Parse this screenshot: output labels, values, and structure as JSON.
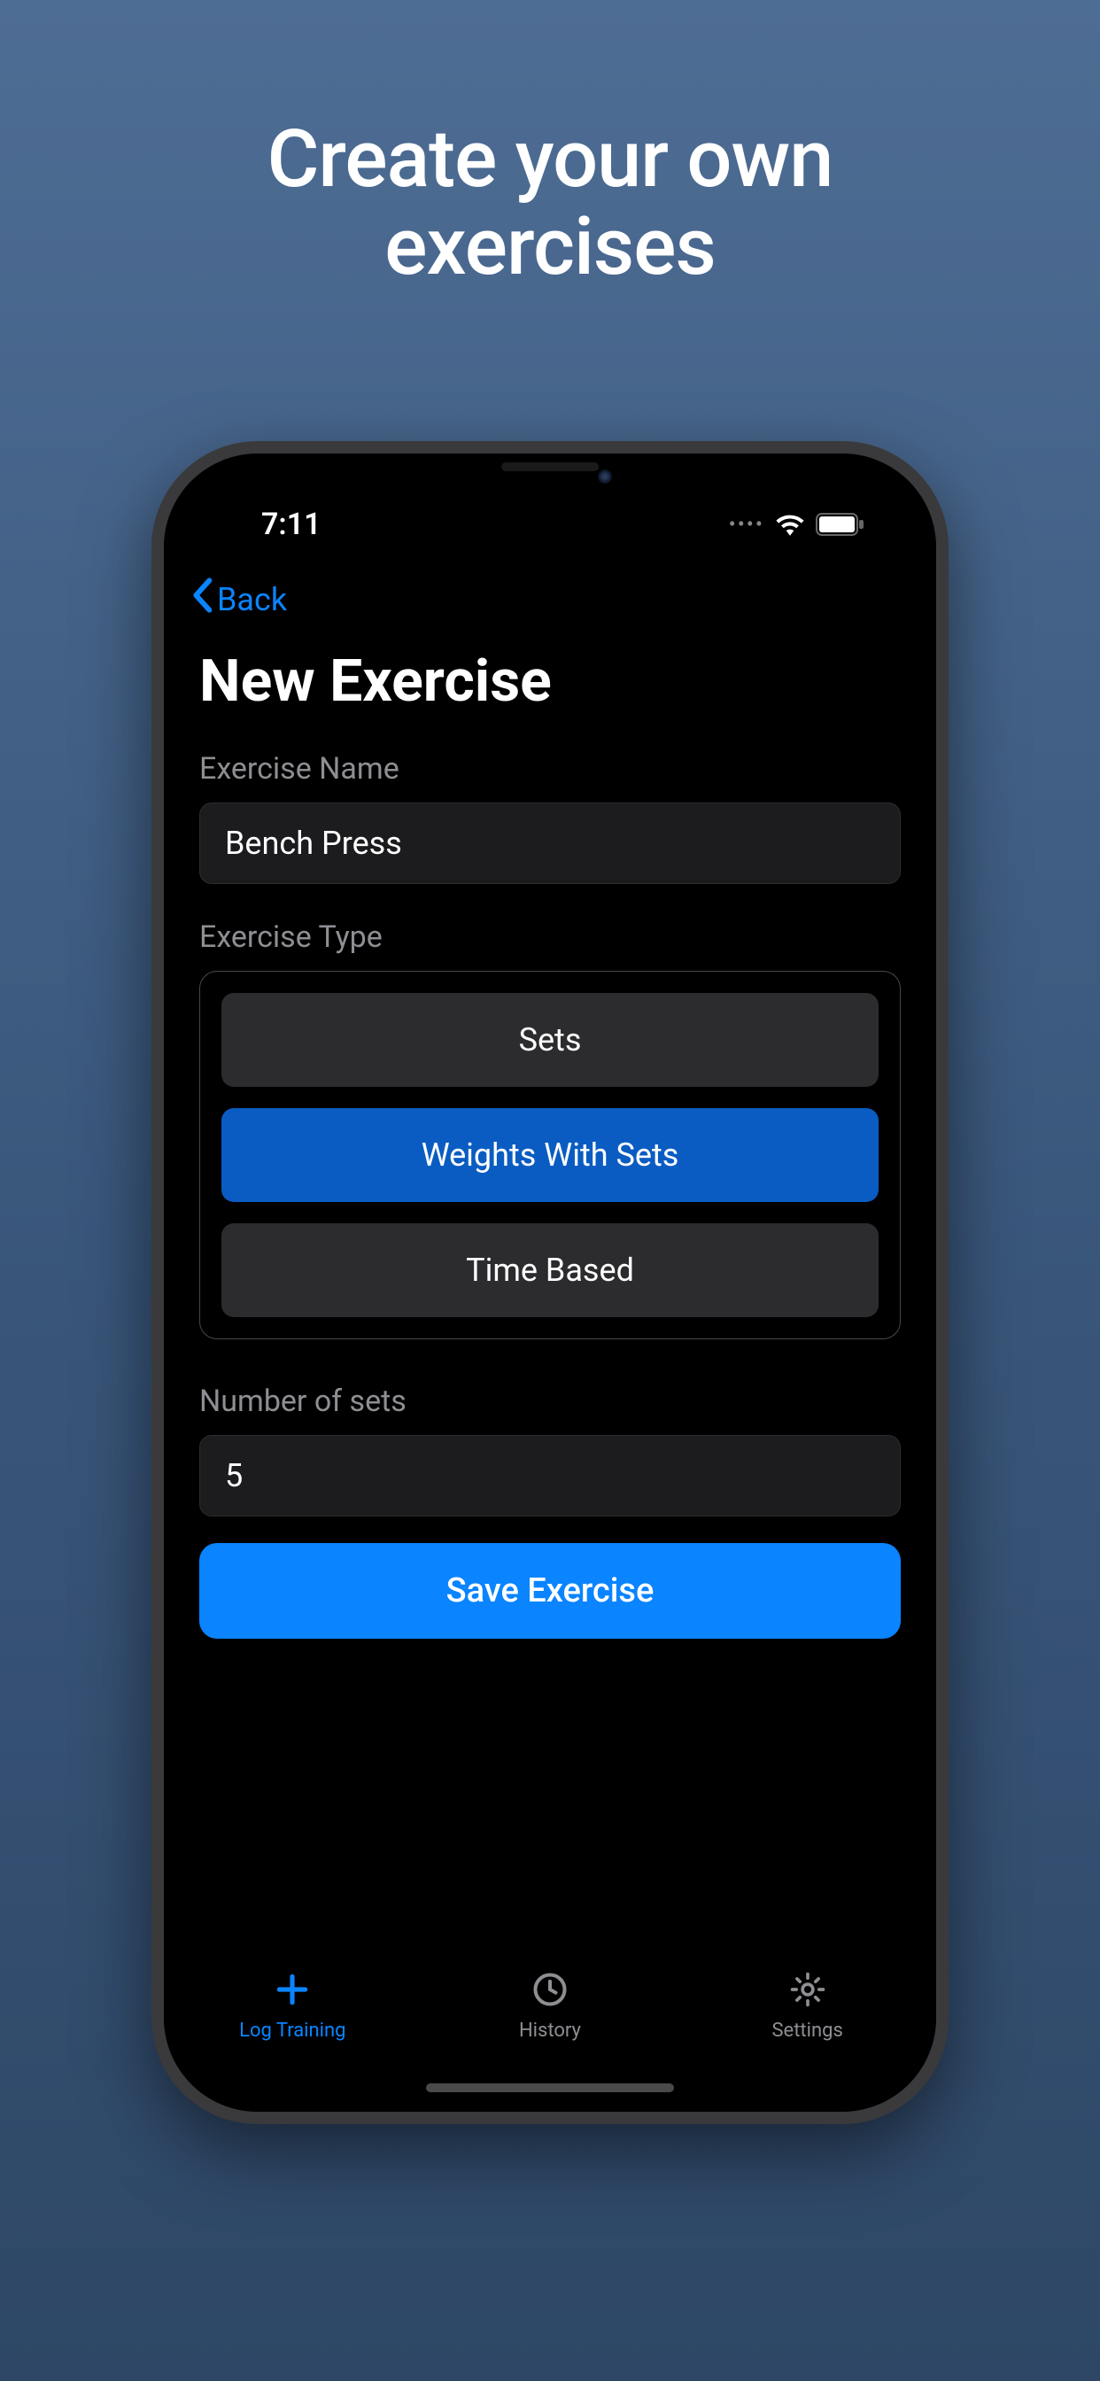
{
  "promo": {
    "title_line1": "Create your own",
    "title_line2": "exercises"
  },
  "status": {
    "time": "7:11"
  },
  "nav": {
    "back_label": "Back"
  },
  "page": {
    "title": "New Exercise"
  },
  "form": {
    "exercise_name_label": "Exercise Name",
    "exercise_name_value": "Bench Press",
    "exercise_type_label": "Exercise Type",
    "type_options": [
      {
        "label": "Sets",
        "selected": false
      },
      {
        "label": "Weights With Sets",
        "selected": true
      },
      {
        "label": "Time Based",
        "selected": false
      }
    ],
    "number_of_sets_label": "Number of sets",
    "number_of_sets_value": "5",
    "save_label": "Save Exercise"
  },
  "tabs": [
    {
      "label": "Log Training",
      "icon": "plus-icon",
      "active": true
    },
    {
      "label": "History",
      "icon": "clock-icon",
      "active": false
    },
    {
      "label": "Settings",
      "icon": "gear-icon",
      "active": false
    }
  ]
}
